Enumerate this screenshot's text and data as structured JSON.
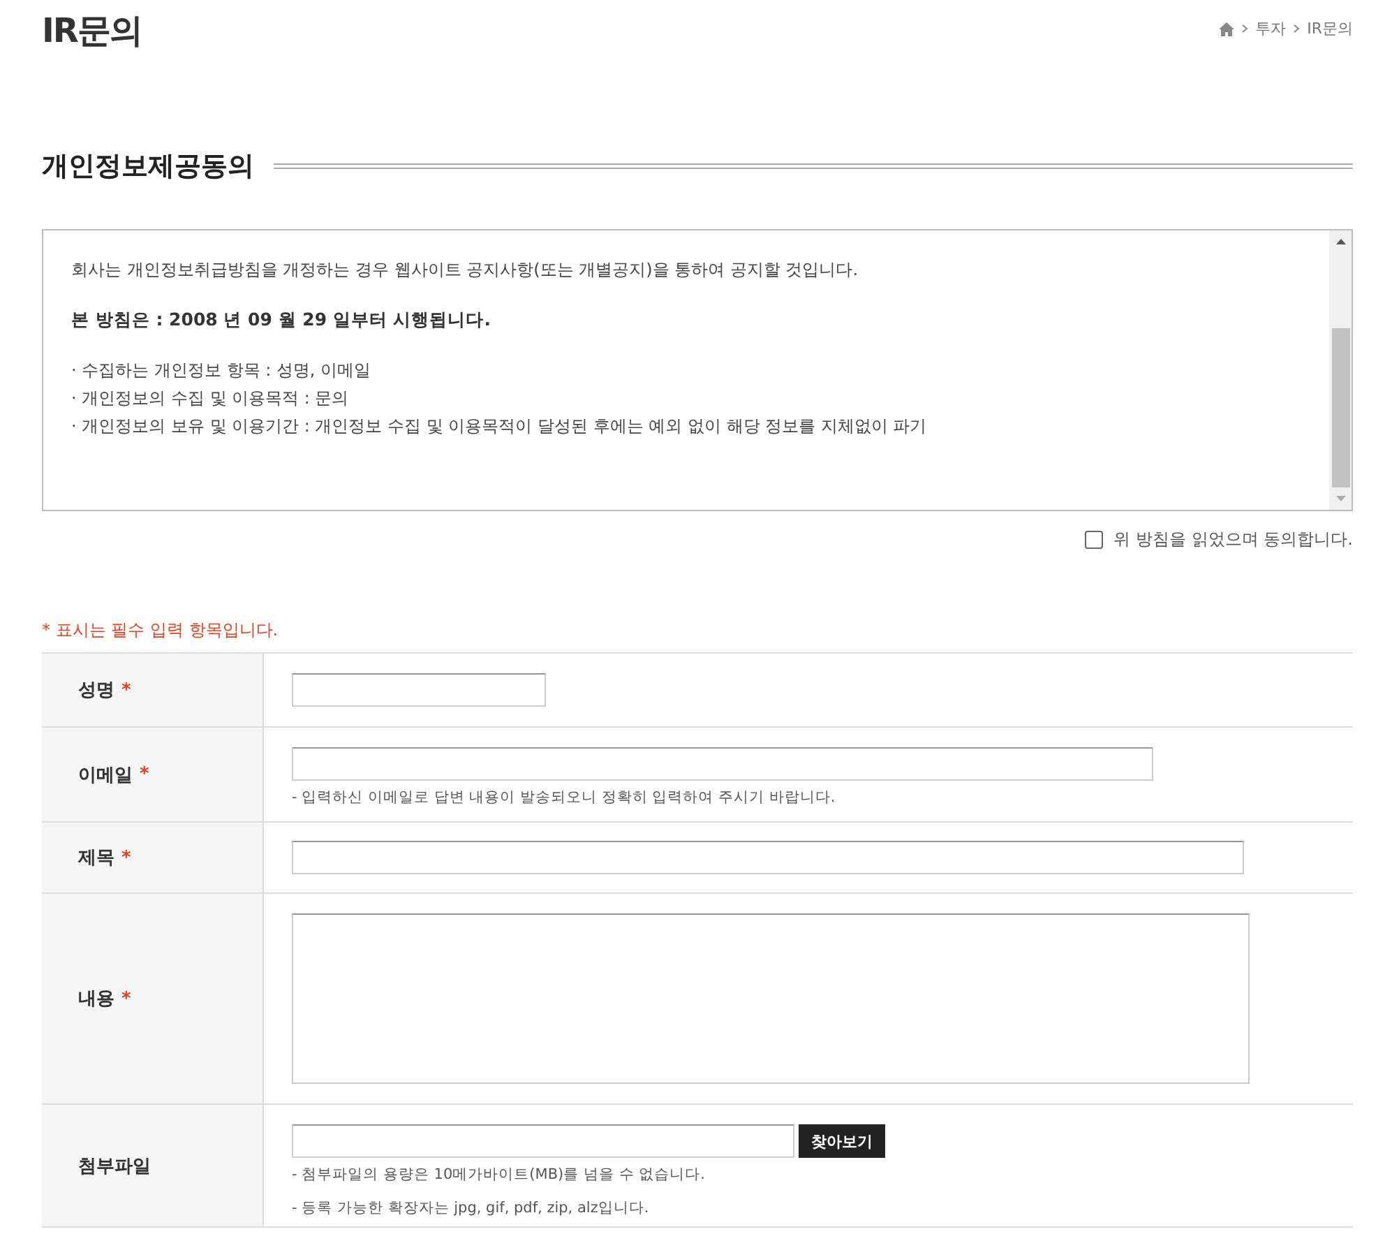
{
  "page_title": "IR문의",
  "breadcrumb": [
    "투자",
    "IR문의"
  ],
  "section_title": "개인정보제공동의",
  "policy": [
    {
      "kind": "text",
      "text": "회사는 개인정보취급방침을 개정하는 경우 웹사이트 공지사항(또는 개별공지)을 통하여 공지할 것입니다."
    },
    {
      "kind": "bold",
      "text": "본 방침은 : 2008 년 09 월 29 일부터 시행됩니다."
    },
    {
      "kind": "bullet",
      "text": "· 수집하는 개인정보 항목 : 성명, 이메일"
    },
    {
      "kind": "bullet",
      "text": "· 개인정보의 수집 및 이용목적 : 문의"
    },
    {
      "kind": "bullet",
      "text": "· 개인정보의 보유 및 이용기간 : 개인정보 수집 및 이용목적이 달성된 후에는 예외 없이 해당 정보를 지체없이 파기"
    }
  ],
  "agree": {
    "label": "위 방침을 읽었으며 동의합니다.",
    "checked": false
  },
  "required_note": "* 표시는 필수 입력 항목입니다.",
  "required_mark": "*",
  "form": [
    {
      "kind": "short",
      "label": "성명",
      "required": true
    },
    {
      "kind": "long",
      "label": "이메일",
      "required": true,
      "hints": [
        "- 입력하신 이메일로 답변 내용이 발송되오니 정확히 입력하여 주시기 바랍니다."
      ]
    },
    {
      "kind": "wide",
      "label": "제목",
      "required": true
    },
    {
      "kind": "textarea",
      "label": "내용",
      "required": true
    },
    {
      "kind": "file",
      "label": "첨부파일",
      "required": false,
      "button": "찾아보기",
      "hints": [
        "- 첨부파일의 용량은 10메가바이트(MB)를 넘을 수 없습니다.",
        "- 등록 가능한 확장자는 jpg, gif, pdf, zip, alz입니다."
      ]
    }
  ]
}
